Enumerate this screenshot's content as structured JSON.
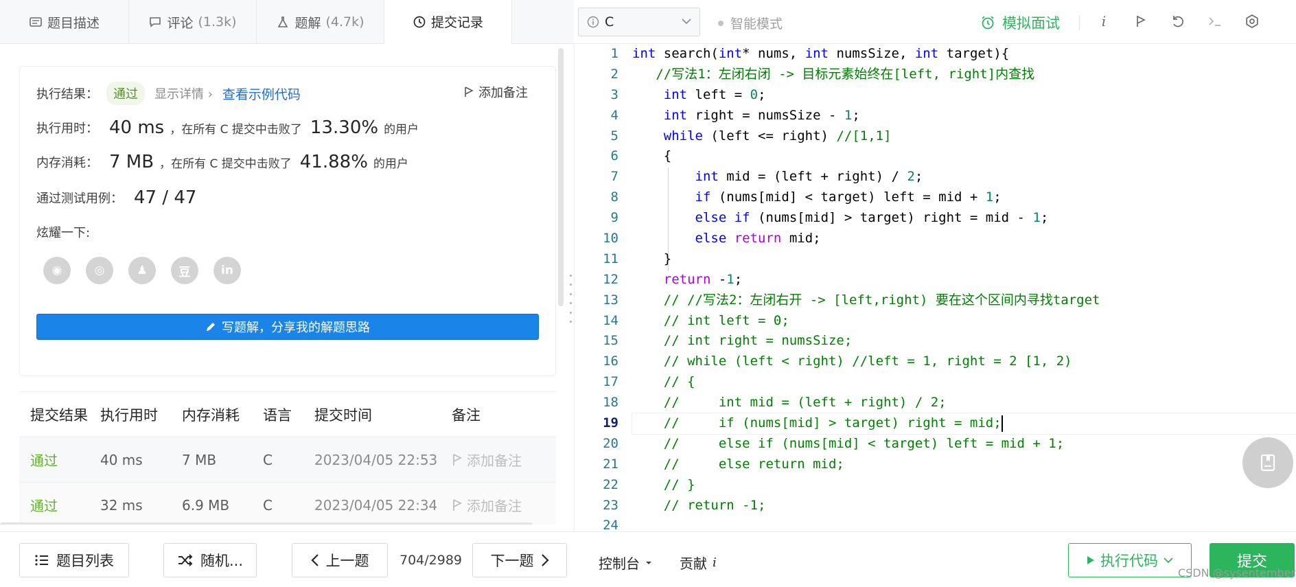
{
  "tabs": [
    {
      "label": "题目描述",
      "sub": "",
      "icon": "description-icon"
    },
    {
      "label": "评论",
      "sub": "(1.3k)",
      "icon": "comment-icon"
    },
    {
      "label": "题解",
      "sub": "(4.7k)",
      "icon": "flask-icon"
    },
    {
      "label": "提交记录",
      "sub": "",
      "icon": "clock-icon"
    }
  ],
  "result": {
    "label": "执行结果：",
    "status": "通过",
    "details": "显示详情 ›",
    "sample_code": "查看示例代码",
    "add_note": "添加备注",
    "time_label": "执行用时：",
    "time_value": "40 ms",
    "time_text": "，在所有 C 提交中击败了",
    "time_pct": "13.30%",
    "time_suffix": "的用户",
    "mem_label": "内存消耗：",
    "mem_value": "7 MB",
    "mem_text": "，在所有 C 提交中击败了",
    "mem_pct": "41.88%",
    "mem_suffix": "的用户",
    "cases_label": "通过测试用例：",
    "cases_value": "47 / 47",
    "share_label": "炫耀一下:",
    "share_icons": [
      "wechat-icon",
      "weibo-icon",
      "qq-icon",
      "douban-icon",
      "linkedin-icon"
    ],
    "share_glyphs": [
      "◉",
      "◎",
      "♟",
      "豆",
      "in"
    ],
    "write_button": "写题解，分享我的解题思路"
  },
  "submissions": {
    "headers": [
      "提交结果",
      "执行用时",
      "内存消耗",
      "语言",
      "提交时间",
      "备注"
    ],
    "rows": [
      {
        "result": "通过",
        "time": "40 ms",
        "memory": "7 MB",
        "lang": "C",
        "submitted": "2023/04/05 22:53",
        "note": "添加备注"
      },
      {
        "result": "通过",
        "time": "32 ms",
        "memory": "6.9 MB",
        "lang": "C",
        "submitted": "2023/04/05 22:34",
        "note": "添加备注"
      }
    ]
  },
  "toolbar": {
    "language": "C",
    "smart_mode": "智能模式",
    "interview": "模拟面试",
    "tool_icons": [
      "info-icon",
      "debug-icon",
      "reset-icon",
      "terminal-icon",
      "settings-icon"
    ]
  },
  "code": {
    "line_numbers": [
      "1",
      "2",
      "3",
      "4",
      "5",
      "6",
      "7",
      "8",
      "9",
      "10",
      "11",
      "12",
      "13",
      "14",
      "15",
      "16",
      "17",
      "18",
      "19",
      "20",
      "21",
      "22",
      "23",
      "24"
    ],
    "current_line": 19,
    "lines": [
      "int search(int* nums, int numsSize, int target){",
      "   //写法1：左闭右闭 -> 目标元素始终在[left, right]内查找",
      "    int left = 0;",
      "    int right = numsSize - 1;",
      "    while (left <= right) //[1,1]",
      "    {",
      "        int mid = (left + right) / 2;",
      "        if (nums[mid] < target) left = mid + 1;",
      "        else if (nums[mid] > target) right = mid - 1;",
      "        else return mid;",
      "    }",
      "    return -1;",
      "    // //写法2：左闭右开 -> [left,right) 要在这个区间内寻找target",
      "    // int left = 0;",
      "    // int right = numsSize;",
      "    // while (left < right) //left = 1, right = 2 [1, 2)",
      "    // {",
      "    //     int mid = (left + right) / 2;",
      "    //     if (nums[mid] > target) right = mid;",
      "    //     else if (nums[mid] < target) left = mid + 1;",
      "    //     else return mid;",
      "    // }",
      "    // return -1;",
      ""
    ]
  },
  "bottom": {
    "problem_list": "题目列表",
    "random": "随机...",
    "prev": "上一题",
    "pager": "704/2989",
    "next": "下一题",
    "console": "控制台",
    "contribute": "贡献",
    "run": "执行代码",
    "submit": "提交",
    "watermark": "CSDN @sysentember"
  },
  "colors": {
    "accent_green": "#2db55d",
    "link_blue": "#1e6fd9",
    "write_button_blue": "#1a84e8"
  }
}
